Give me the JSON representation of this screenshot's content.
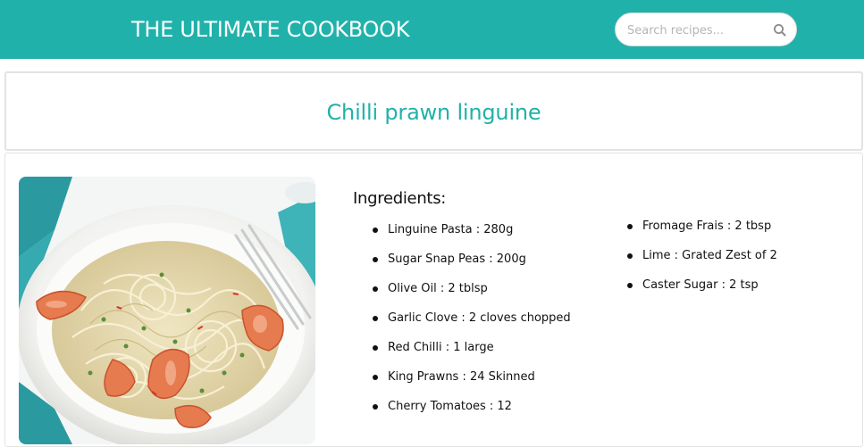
{
  "header": {
    "brand": "THE ULTIMATE COOKBOOK",
    "search_placeholder": "Search recipes...",
    "search_icon": "magnifier",
    "background_color": "#20b2aa"
  },
  "recipe": {
    "title": "Chilli prawn linguine",
    "title_color": "#20b2aa",
    "image_alt": "Chilli prawn linguine",
    "ingredients_heading": "Ingredients:",
    "ingredients_col1": [
      {
        "text": "Linguine Pasta : 280g"
      },
      {
        "text": "Sugar Snap Peas : 200g"
      },
      {
        "text": "Olive Oil : 2 tblsp"
      },
      {
        "text": "Garlic Clove : 2 cloves chopped"
      },
      {
        "text": "Red Chilli : 1 large"
      },
      {
        "text": "King Prawns : 24 Skinned"
      },
      {
        "text": "Cherry Tomatoes : 12"
      }
    ],
    "ingredients_col2": [
      {
        "text": "Fromage Frais : 2 tbsp"
      },
      {
        "text": "Lime : Grated Zest of 2"
      },
      {
        "text": "Caster Sugar : 2 tsp"
      }
    ]
  }
}
